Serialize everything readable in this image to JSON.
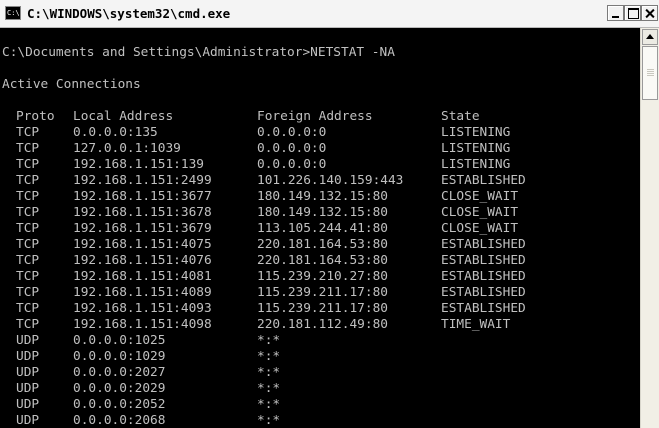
{
  "window": {
    "title": "C:\\WINDOWS\\system32\\cmd.exe",
    "icon_text": "C:\\"
  },
  "console": {
    "command": "C:\\Documents and Settings\\Administrator>NETSTAT -NA",
    "heading": "Active Connections",
    "columns": {
      "proto": "Proto",
      "local": "Local Address",
      "foreign": "Foreign Address",
      "state": "State"
    },
    "rows": [
      {
        "proto": "TCP",
        "local": "0.0.0.0:135",
        "foreign": "0.0.0.0:0",
        "state": "LISTENING"
      },
      {
        "proto": "TCP",
        "local": "127.0.0.1:1039",
        "foreign": "0.0.0.0:0",
        "state": "LISTENING"
      },
      {
        "proto": "TCP",
        "local": "192.168.1.151:139",
        "foreign": "0.0.0.0:0",
        "state": "LISTENING"
      },
      {
        "proto": "TCP",
        "local": "192.168.1.151:2499",
        "foreign": "101.226.140.159:443",
        "state": "ESTABLISHED"
      },
      {
        "proto": "TCP",
        "local": "192.168.1.151:3677",
        "foreign": "180.149.132.15:80",
        "state": "CLOSE_WAIT"
      },
      {
        "proto": "TCP",
        "local": "192.168.1.151:3678",
        "foreign": "180.149.132.15:80",
        "state": "CLOSE_WAIT"
      },
      {
        "proto": "TCP",
        "local": "192.168.1.151:3679",
        "foreign": "113.105.244.41:80",
        "state": "CLOSE_WAIT"
      },
      {
        "proto": "TCP",
        "local": "192.168.1.151:4075",
        "foreign": "220.181.164.53:80",
        "state": "ESTABLISHED"
      },
      {
        "proto": "TCP",
        "local": "192.168.1.151:4076",
        "foreign": "220.181.164.53:80",
        "state": "ESTABLISHED"
      },
      {
        "proto": "TCP",
        "local": "192.168.1.151:4081",
        "foreign": "115.239.210.27:80",
        "state": "ESTABLISHED"
      },
      {
        "proto": "TCP",
        "local": "192.168.1.151:4089",
        "foreign": "115.239.211.17:80",
        "state": "ESTABLISHED"
      },
      {
        "proto": "TCP",
        "local": "192.168.1.151:4093",
        "foreign": "115.239.211.17:80",
        "state": "ESTABLISHED"
      },
      {
        "proto": "TCP",
        "local": "192.168.1.151:4098",
        "foreign": "220.181.112.49:80",
        "state": "TIME_WAIT"
      },
      {
        "proto": "UDP",
        "local": "0.0.0.0:1025",
        "foreign": "*:*",
        "state": ""
      },
      {
        "proto": "UDP",
        "local": "0.0.0.0:1029",
        "foreign": "*:*",
        "state": ""
      },
      {
        "proto": "UDP",
        "local": "0.0.0.0:2027",
        "foreign": "*:*",
        "state": ""
      },
      {
        "proto": "UDP",
        "local": "0.0.0.0:2029",
        "foreign": "*:*",
        "state": ""
      },
      {
        "proto": "UDP",
        "local": "0.0.0.0:2052",
        "foreign": "*:*",
        "state": ""
      },
      {
        "proto": "UDP",
        "local": "0.0.0.0:2068",
        "foreign": "*:*",
        "state": ""
      }
    ]
  },
  "colors": {
    "console_background": "#000000",
    "console_text": "#c0c0c0",
    "titlebar": "#f4f4f4"
  },
  "icons": {
    "app": "cmd-icon",
    "minimize": "minimize-icon",
    "maximize": "maximize-icon",
    "close": "close-icon",
    "scroll_up": "scroll-up-arrow-icon"
  }
}
